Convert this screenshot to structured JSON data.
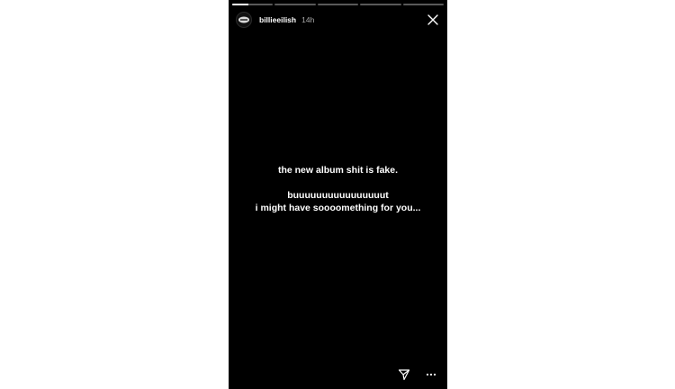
{
  "story": {
    "progress": [
      0.4,
      0,
      0,
      0,
      0
    ],
    "user": {
      "username": "billieeilish",
      "time": "14h"
    },
    "message": {
      "line1": "the new album shit is fake.",
      "line2": "buuuuuuuuuuuuuuuut",
      "line3": "i might have soooomething for you..."
    },
    "icons": {
      "close": "close-icon",
      "send": "send-icon",
      "more": "more-icon"
    },
    "colors": {
      "background": "#000000",
      "text": "#ffffff"
    }
  }
}
